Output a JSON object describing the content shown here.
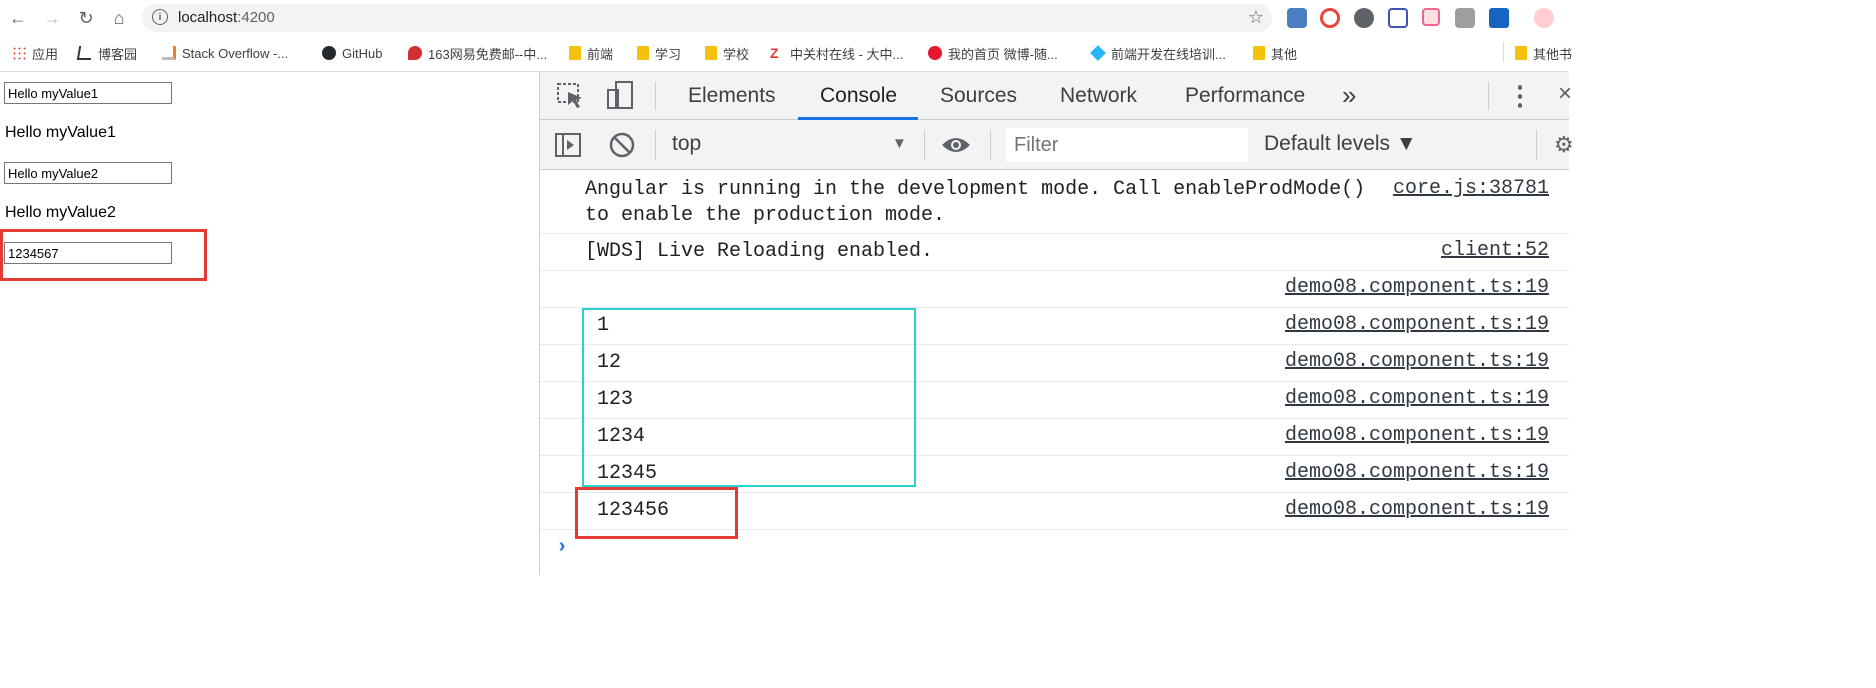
{
  "browser": {
    "url_host": "localhost",
    "url_port": ":4200"
  },
  "bookmarks": [
    {
      "label": "应用",
      "icon": "apps-grid-icon"
    },
    {
      "label": "博客园",
      "icon": "cnblogs-icon"
    },
    {
      "label": "Stack Overflow -...",
      "icon": "stackoverflow-icon"
    },
    {
      "label": "GitHub",
      "icon": "github-icon"
    },
    {
      "label": "163网易免费邮--中...",
      "icon": "mail163-icon"
    },
    {
      "label": "前端",
      "icon": "folder-icon"
    },
    {
      "label": "学习",
      "icon": "folder-icon"
    },
    {
      "label": "学校",
      "icon": "folder-icon"
    },
    {
      "label": "中关村在线 - 大中...",
      "icon": "zol-icon"
    },
    {
      "label": "我的首页 微博-随...",
      "icon": "weibo-icon"
    },
    {
      "label": "前端开发在线培训...",
      "icon": "training-icon"
    },
    {
      "label": "其他",
      "icon": "folder-icon"
    },
    {
      "label": "其他书",
      "icon": "folder-icon"
    }
  ],
  "page": {
    "input1_value": "Hello myValue1",
    "output1": "Hello myValue1",
    "input2_value": "Hello myValue2",
    "output2": "Hello myValue2",
    "input3_value": "1234567"
  },
  "devtools": {
    "tabs": [
      "Elements",
      "Console",
      "Sources",
      "Network",
      "Performance"
    ],
    "active_tab": "Console",
    "more_tabs": "»",
    "context": "top",
    "filter_placeholder": "Filter",
    "levels": "Default levels ▼",
    "console_messages": [
      {
        "text": "Angular is running in the development mode. Call enableProdMode()\nto enable the production mode.",
        "source": "core.js:38781"
      },
      {
        "text": "[WDS] Live Reloading enabled.",
        "source": "client:52"
      },
      {
        "text": "",
        "source": "demo08.component.ts:19"
      },
      {
        "text": "1",
        "source": "demo08.component.ts:19"
      },
      {
        "text": "12",
        "source": "demo08.component.ts:19"
      },
      {
        "text": "123",
        "source": "demo08.component.ts:19"
      },
      {
        "text": "1234",
        "source": "demo08.component.ts:19"
      },
      {
        "text": "12345",
        "source": "demo08.component.ts:19"
      },
      {
        "text": "123456",
        "source": "demo08.component.ts:19"
      }
    ],
    "prompt": "›"
  },
  "colors": {
    "highlight_red": "#e53935",
    "highlight_cyan": "#29d1d1",
    "active_tab_underline": "#1a73e8"
  }
}
